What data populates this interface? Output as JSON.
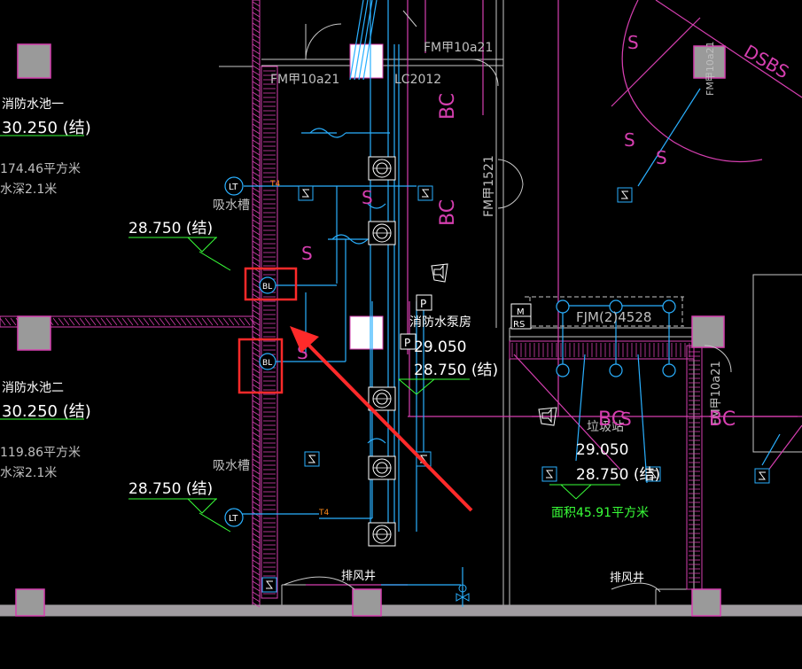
{
  "colors": {
    "background": "#000000",
    "wall": "#c8c8c8",
    "magenta": "#d63fb0",
    "cyan": "#2ab0ff",
    "green": "#39ff39",
    "red_highlight": "#ff2a2a",
    "column": "#9a9a9a"
  },
  "left_rooms": [
    {
      "name": "消防水池一",
      "level": "30.250 (结)",
      "area": "174.46平方米",
      "depth": "水深2.1米"
    },
    {
      "name": "消防水池二",
      "level": "30.250 (结)",
      "area": "119.86平方米",
      "depth": "水深2.1米"
    }
  ],
  "sump_labels": [
    "吸水槽",
    "吸水槽"
  ],
  "side_levels": [
    "28.750 (结)",
    "28.750 (结)"
  ],
  "door_labels": {
    "fm_top": "FM甲10a21",
    "fm_top_left": "FM甲10a21",
    "lc": "LC2012",
    "fm_vertical": "FM甲1521",
    "fjm": "FJM(2)4528",
    "fm_right": "FM甲10a21",
    "fm_corner": "FM甲10a21"
  },
  "pump_room": {
    "name": "消防水泵房",
    "level1": "29.050",
    "level2": "28.750 (结)"
  },
  "trash_room": {
    "name": "垃圾站",
    "level1": "29.050",
    "level2": "28.750 (结)",
    "area": "面积45.91平方米"
  },
  "shafts": [
    "排风井",
    "排风井"
  ],
  "pipe_tags": {
    "bl": "BL",
    "lt": "LT",
    "s": "S",
    "p": "P",
    "m": "M",
    "rs": "RS",
    "t4": "T4",
    "bc": "BC"
  },
  "corner_text": "DSBS"
}
